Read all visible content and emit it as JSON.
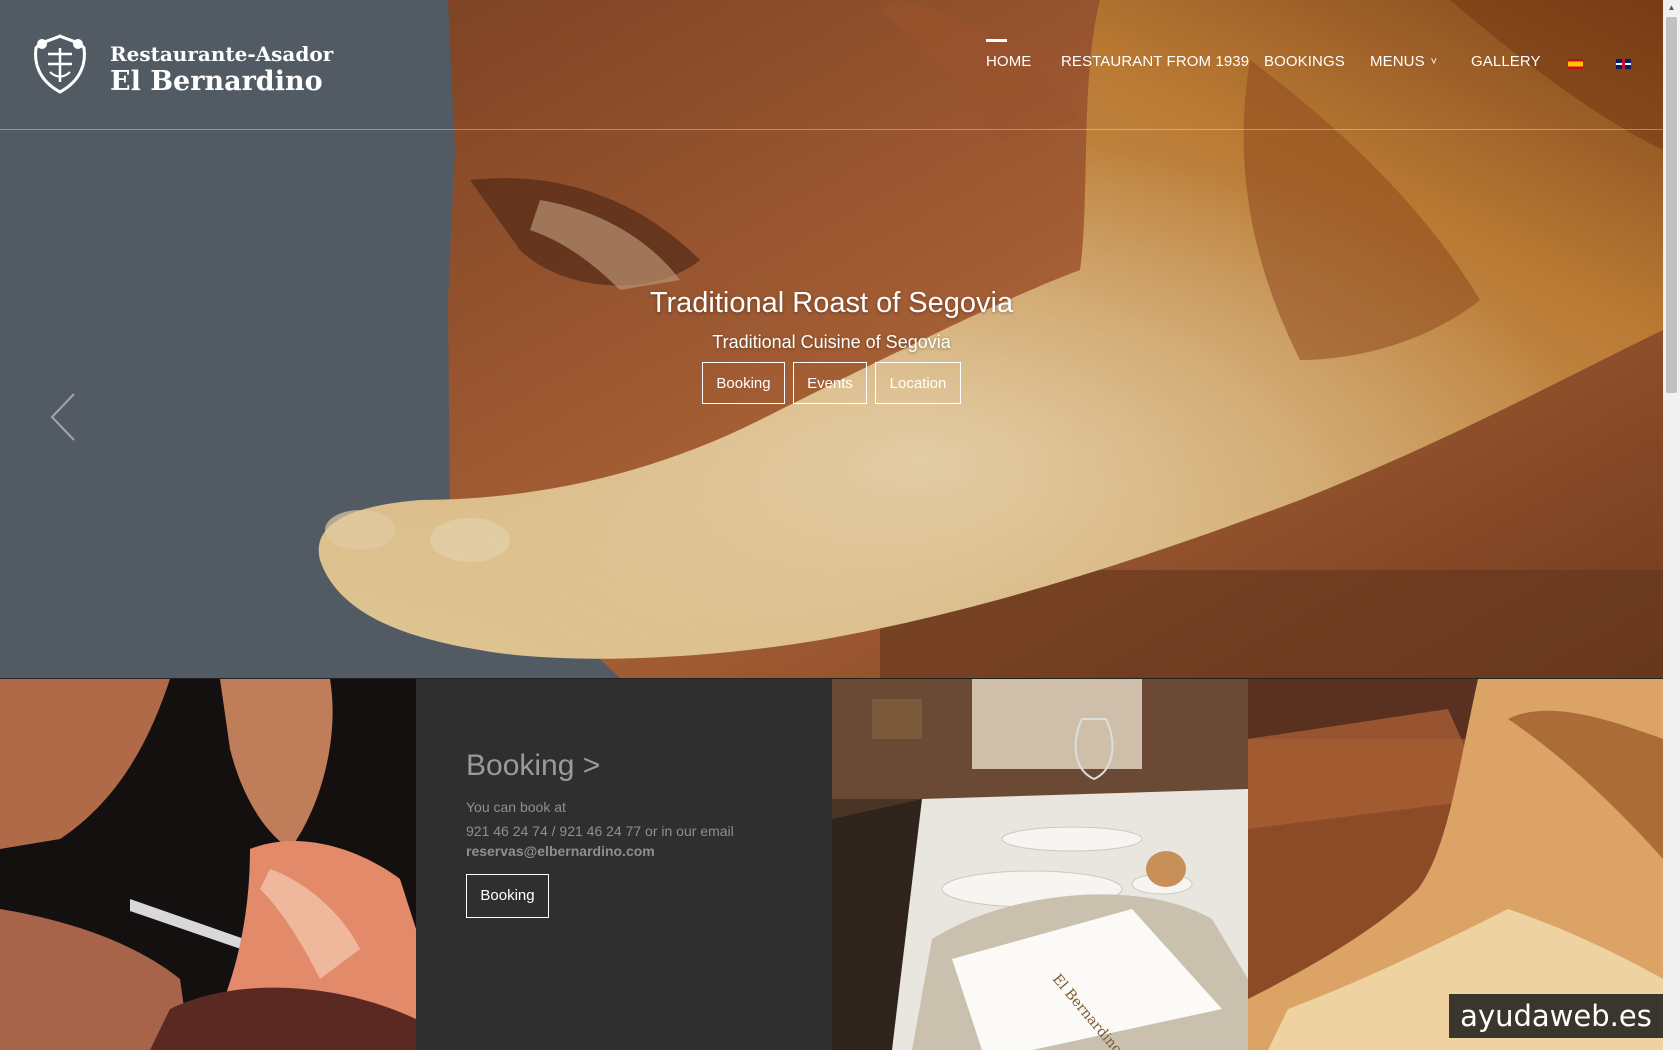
{
  "logo": {
    "line1": "Restaurante-Asador",
    "line2": "El Bernardino"
  },
  "nav": {
    "items": [
      "HOME",
      "RESTAURANT FROM 1939",
      "BOOKINGS",
      "MENUS",
      "GALLERY"
    ],
    "active": "HOME",
    "menus_dropdown_icon": "chevron-down-icon",
    "languages": [
      "es",
      "en"
    ]
  },
  "hero": {
    "title": "Traditional Roast of Segovia",
    "subtitle": "Traditional Cuisine of Segovia",
    "buttons": [
      "Booking",
      "Events",
      "Location"
    ],
    "prev_icon": "chevron-left-icon"
  },
  "booking": {
    "title": "Booking >",
    "line1": "You can book at",
    "line2": "921 46 24 74 / 921 46 24 77 or in our email",
    "email": "reservas@elbernardino.com",
    "button": "Booking"
  },
  "watermark": "ayudaweb.es",
  "colors": {
    "panel": "#2f2f2f",
    "text_muted": "#9a9a9a",
    "white": "#ffffff"
  }
}
